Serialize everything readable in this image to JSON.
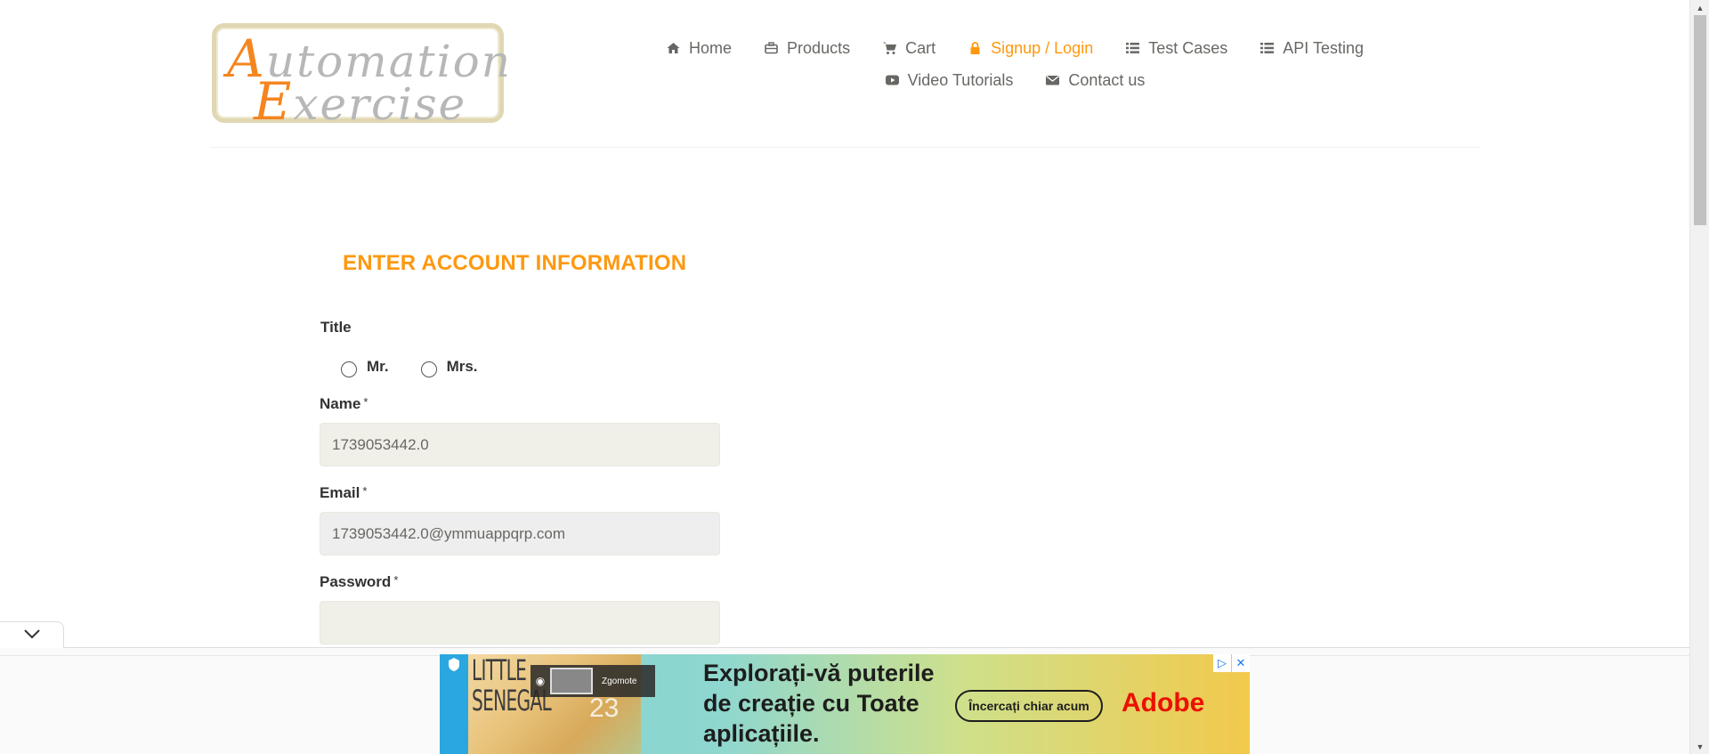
{
  "header": {
    "logo": {
      "line1_first": "A",
      "line1_rest": "utomation",
      "line2_first": "E",
      "line2_rest": "xercise"
    },
    "nav_row1": [
      {
        "label": "Home",
        "icon": "home-icon"
      },
      {
        "label": "Products",
        "icon": "products-icon"
      },
      {
        "label": "Cart",
        "icon": "cart-icon"
      },
      {
        "label": "Signup / Login",
        "icon": "lock-icon",
        "active": true
      },
      {
        "label": "Test Cases",
        "icon": "list-icon"
      },
      {
        "label": "API Testing",
        "icon": "list-icon"
      }
    ],
    "nav_row2": [
      {
        "label": "Video Tutorials",
        "icon": "youtube-icon"
      },
      {
        "label": "Contact us",
        "icon": "envelope-icon"
      }
    ],
    "active_color": "#fe980f"
  },
  "form": {
    "heading": "ENTER ACCOUNT INFORMATION",
    "title_label": "Title",
    "title_options": [
      "Mr.",
      "Mrs."
    ],
    "name_label": "Name",
    "name_value": "1739053442.0",
    "email_label": "Email",
    "email_value": "1739053442.0@ymmuappqrp.com",
    "password_label": "Password",
    "password_value": "",
    "required_marker": "*"
  },
  "ad": {
    "movie_title_line1": "LITTLE",
    "movie_title_line2": "SENEGAL",
    "movie_number": "23",
    "sound_label": "Zgomote",
    "headline_line1": "Explorați-vă puterile",
    "headline_line2": "de creație cu Toate",
    "headline_line3": "aplicațiile.",
    "cta": "Încercați chiar acum",
    "brand": "Adobe"
  }
}
